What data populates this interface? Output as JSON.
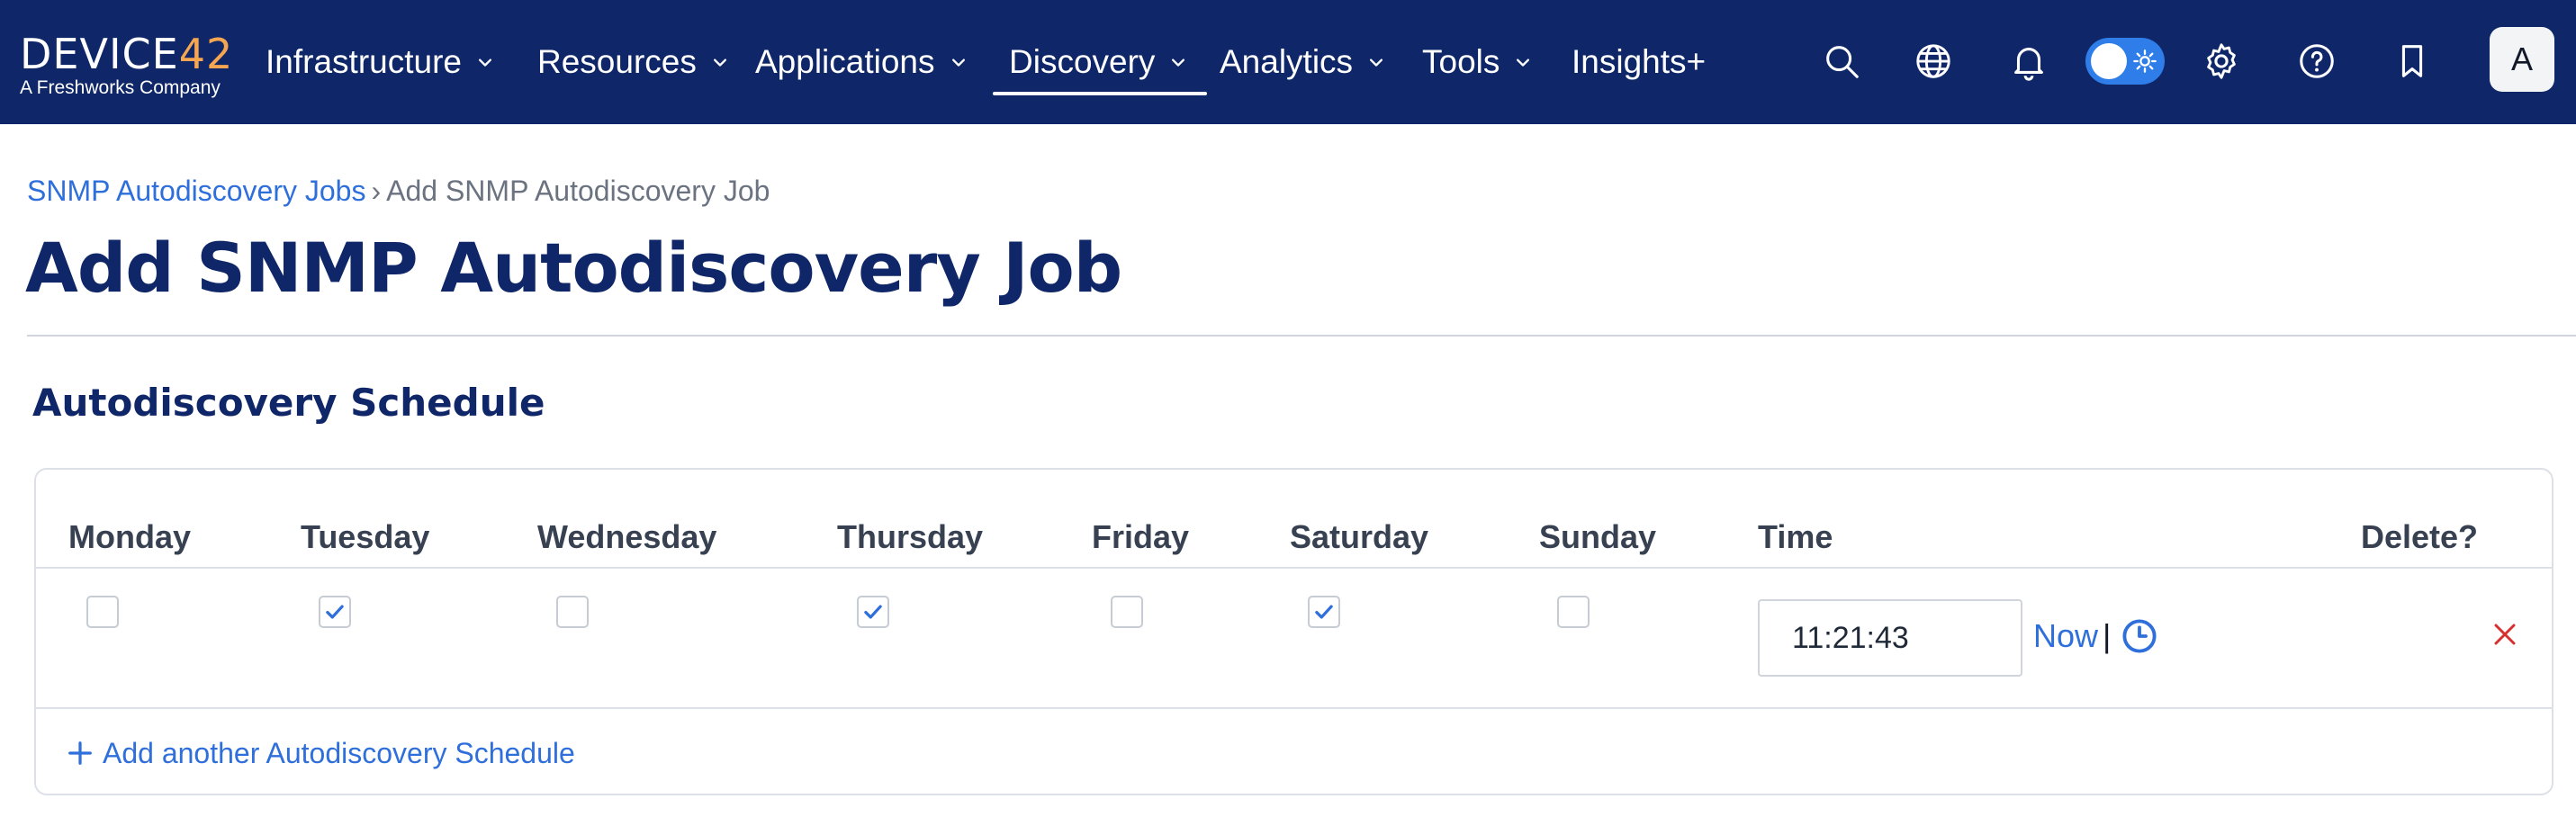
{
  "brand": {
    "logo_main": "DEVICE",
    "logo_accent": "42",
    "logo_sub": "A Freshworks Company",
    "accent_color": "#f6a650"
  },
  "nav": {
    "items": [
      {
        "label": "Infrastructure",
        "has_dropdown": true
      },
      {
        "label": "Resources",
        "has_dropdown": true
      },
      {
        "label": "Applications",
        "has_dropdown": true
      },
      {
        "label": "Discovery",
        "has_dropdown": true,
        "active": true
      },
      {
        "label": "Analytics",
        "has_dropdown": true
      },
      {
        "label": "Tools",
        "has_dropdown": true
      },
      {
        "label": "Insights+",
        "has_dropdown": false
      }
    ],
    "icons": [
      "search-icon",
      "globe-icon",
      "bell-icon",
      "theme-toggle",
      "gear-icon",
      "help-icon",
      "bookmark-icon"
    ],
    "avatar_initial": "A",
    "background_color": "#0f2768"
  },
  "breadcrumb": {
    "parent": "SNMP Autodiscovery Jobs",
    "separator": "›",
    "current": "Add SNMP Autodiscovery Job"
  },
  "page_title": "Add SNMP Autodiscovery Job",
  "schedule": {
    "section_title": "Autodiscovery Schedule",
    "columns": [
      "Monday",
      "Tuesday",
      "Wednesday",
      "Thursday",
      "Friday",
      "Saturday",
      "Sunday",
      "Time",
      "Delete?"
    ],
    "rows": [
      {
        "days": {
          "Monday": false,
          "Tuesday": true,
          "Wednesday": false,
          "Thursday": true,
          "Friday": false,
          "Saturday": true,
          "Sunday": false
        },
        "time": "11:21:43",
        "now_label": "Now",
        "now_separator": "|"
      }
    ],
    "add_label": "Add another Autodiscovery Schedule"
  },
  "colors": {
    "link": "#2f6fdb",
    "checkbox_checked": "#2f6fdb",
    "delete": "#d62f2f",
    "title": "#0f2768"
  }
}
